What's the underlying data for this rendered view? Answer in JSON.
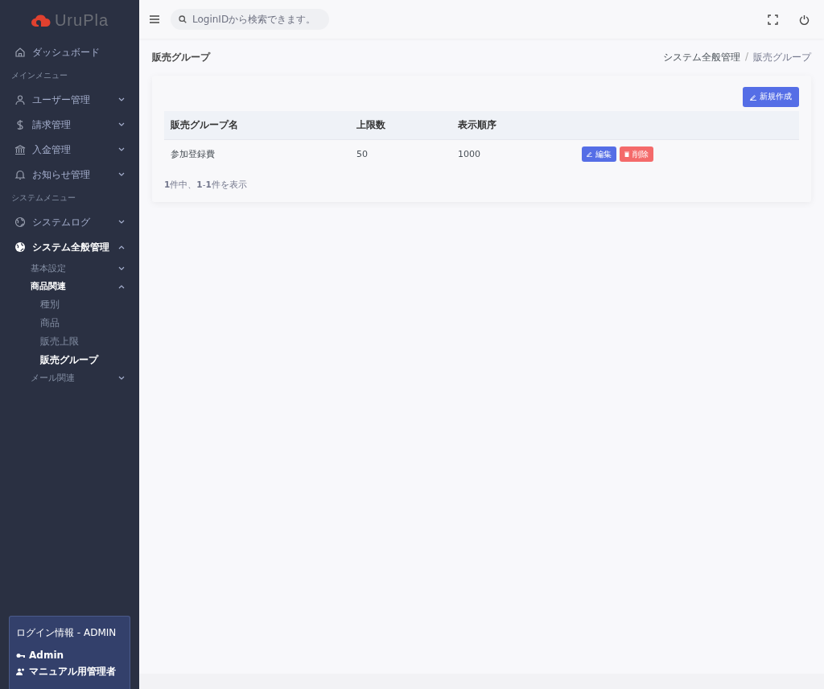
{
  "brand": {
    "name": "UruPla"
  },
  "search": {
    "placeholder": "LoginIDから検索できます。"
  },
  "nav": [
    {
      "kind": "item",
      "label": "ダッシュボード"
    },
    {
      "kind": "section",
      "label": "メインメニュー"
    },
    {
      "kind": "item",
      "label": "ユーザー管理",
      "expanded": false
    },
    {
      "kind": "item",
      "label": "請求管理",
      "expanded": false
    },
    {
      "kind": "item",
      "label": "入金管理",
      "expanded": false
    },
    {
      "kind": "item",
      "label": "お知らせ管理",
      "expanded": false
    },
    {
      "kind": "section",
      "label": "システムメニュー"
    },
    {
      "kind": "item",
      "label": "システムログ",
      "expanded": false
    },
    {
      "kind": "item",
      "label": "システム全般管理",
      "expanded": true,
      "children": [
        {
          "label": "基本設定",
          "expanded": false
        },
        {
          "label": "商品関連",
          "expanded": true,
          "children": [
            {
              "label": "種別",
              "selected": false
            },
            {
              "label": "商品",
              "selected": false
            },
            {
              "label": "販売上限",
              "selected": false
            },
            {
              "label": "販売グループ",
              "selected": true
            }
          ]
        },
        {
          "label": "メール関連",
          "expanded": false
        }
      ]
    }
  ],
  "login": {
    "title": "ログイン情報 - ADMIN",
    "user": "Admin",
    "role": "マニュアル用管理者"
  },
  "page": {
    "title": "販売グループ",
    "breadcrumb": [
      "システム全般管理",
      "販売グループ"
    ],
    "breadcrumb_separator": "/"
  },
  "create_button": "新規作成",
  "table": {
    "columns": [
      "販売グループ名",
      "上限数",
      "表示順序"
    ],
    "rows": [
      {
        "cells": [
          "参加登録費",
          "50",
          "1000"
        ],
        "actions": [
          "編集",
          "削除"
        ]
      }
    ]
  },
  "summary": "**1**件中、**1**-**1**件を表示"
}
